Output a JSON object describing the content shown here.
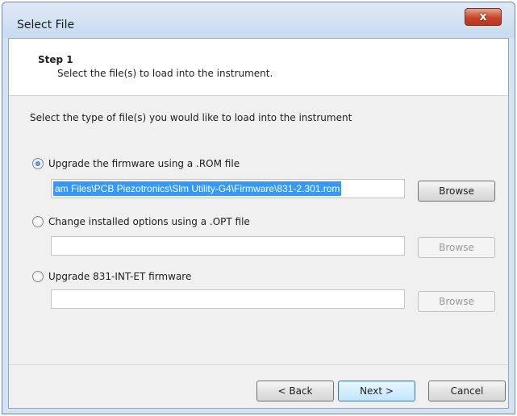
{
  "window": {
    "title": "Select File",
    "close_glyph": "x"
  },
  "step": {
    "title": "Step 1",
    "description": "Select the file(s) to load into the instrument."
  },
  "prompt": "Select the type of file(s) you would like to load into the instrument",
  "options": [
    {
      "label": "Upgrade the firmware using a .ROM file",
      "checked": true,
      "path": "am Files\\PCB Piezotronics\\Slm Utility-G4\\Firmware\\831-2.301.rom",
      "browse": "Browse",
      "browse_enabled": true
    },
    {
      "label": "Change installed options using a .OPT file",
      "checked": false,
      "path": "",
      "browse": "Browse",
      "browse_enabled": false
    },
    {
      "label": "Upgrade 831-INT-ET firmware",
      "checked": false,
      "path": "",
      "browse": "Browse",
      "browse_enabled": false
    }
  ],
  "buttons": {
    "back": "< Back",
    "next": "Next >",
    "cancel": "Cancel"
  },
  "colors": {
    "selection": "#3399ff",
    "close_button": "#c9452a",
    "title_bar": "#d4e3f4"
  }
}
